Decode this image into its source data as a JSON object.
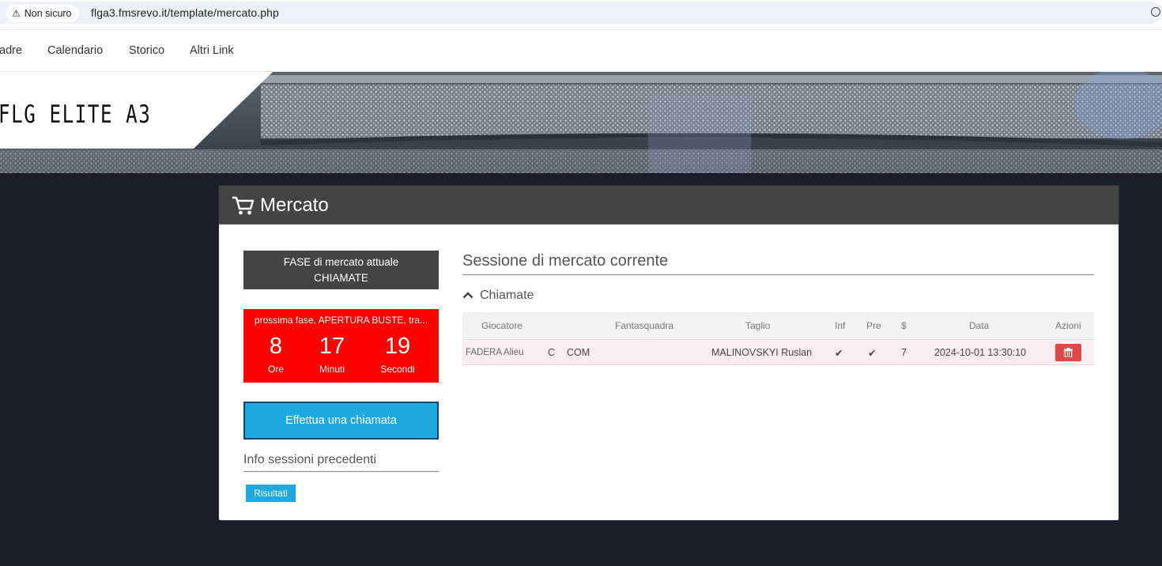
{
  "browser": {
    "security_label": "Non sicuro",
    "url": "flga3.fmsrevo.it/template/mercato.php"
  },
  "nav": {
    "items": [
      "adre",
      "Calendario",
      "Storico",
      "Altri Link"
    ]
  },
  "banner": {
    "logo_text": "FLG ELITE A3"
  },
  "panel": {
    "title": "Mercato",
    "phase_line1": "FASE di mercato attuale",
    "phase_line2": "CHIAMATE",
    "next_phase": "prossima fase, APERTURA BUSTE, tra...",
    "countdown": [
      {
        "value": "8",
        "label": "Ore"
      },
      {
        "value": "17",
        "label": "Minuti"
      },
      {
        "value": "19",
        "label": "Secondi"
      }
    ],
    "call_button": "Effettua una chiamata",
    "previous_sessions_title": "Info sessioni precedenti",
    "results_button": "Risultati"
  },
  "session": {
    "title": "Sessione di mercato corrente",
    "section": "Chiamate",
    "columns": [
      "Giocatore",
      "Fantasquadra",
      "Taglio",
      "Inf",
      "Pre",
      "$",
      "Data",
      "Azioni"
    ],
    "rows": [
      {
        "player": "FADERA Alieu",
        "role": "C",
        "club": "COM",
        "fantasquadra": "",
        "taglio": "MALINOVSKYI Ruslan",
        "inf": "✔",
        "pre": "✔",
        "price": "7",
        "date": "2024-10-01 13:30:10"
      }
    ]
  },
  "colors": {
    "header_dark": "#444444",
    "countdown_red": "#ff0000",
    "accent_blue": "#1ea8e0",
    "delete_red": "#e04848",
    "page_bg": "#1b1d2a"
  }
}
